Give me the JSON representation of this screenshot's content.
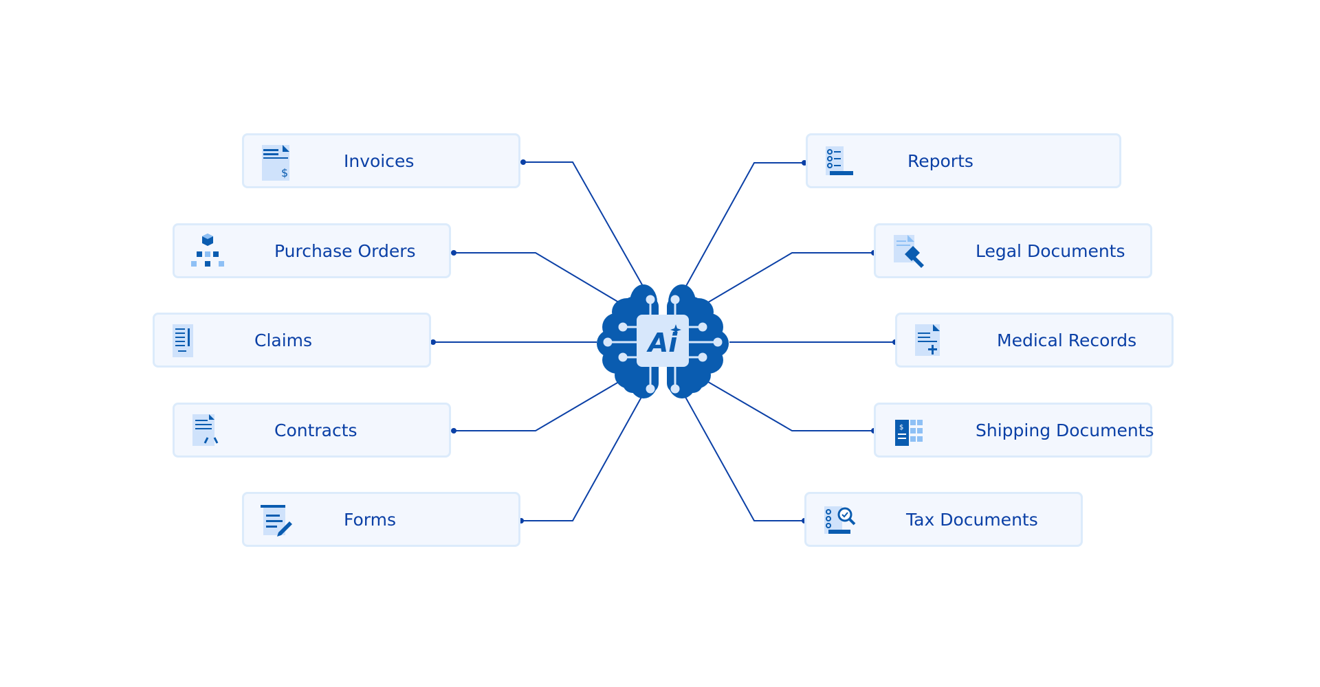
{
  "colors": {
    "line": "#0b40a6",
    "brain": "#0a5cb0",
    "chip": "#d7e7fb",
    "box_bg": "#f3f7fe",
    "box_border": "#dcebfb",
    "text": "#0b40a6"
  },
  "center": {
    "icon": "ai-brain-icon",
    "chip_text": "Ai"
  },
  "left_nodes": [
    {
      "label": "Invoices",
      "icon": "invoice-icon"
    },
    {
      "label": "Purchase Orders",
      "icon": "hierarchy-icon"
    },
    {
      "label": "Claims",
      "icon": "claim-document-icon"
    },
    {
      "label": "Contracts",
      "icon": "contract-icon"
    },
    {
      "label": "Forms",
      "icon": "form-edit-icon"
    }
  ],
  "right_nodes": [
    {
      "label": "Reports",
      "icon": "report-checklist-icon"
    },
    {
      "label": "Legal Documents",
      "icon": "gavel-icon"
    },
    {
      "label": "Medical Records",
      "icon": "medical-record-icon"
    },
    {
      "label": "Shipping Documents",
      "icon": "shipping-document-icon"
    },
    {
      "label": "Tax Documents",
      "icon": "tax-search-icon"
    }
  ]
}
